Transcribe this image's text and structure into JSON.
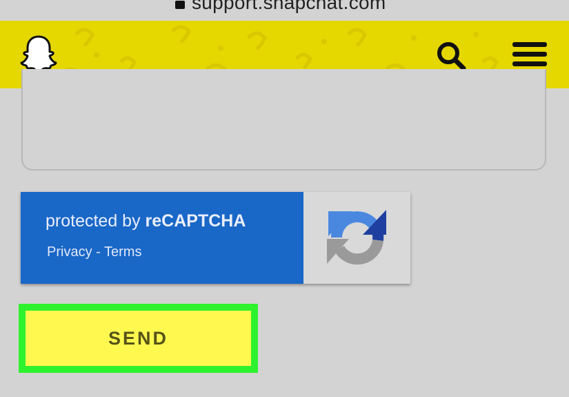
{
  "browser": {
    "url": "support.snapchat.com"
  },
  "header": {
    "logo_icon": "snapchat-ghost-icon",
    "search_icon": "search-icon",
    "menu_icon": "hamburger-menu-icon",
    "background_color": "#e5d700"
  },
  "recaptcha": {
    "protected_prefix": "protected by ",
    "brand": "reCAPTCHA",
    "privacy_label": "Privacy",
    "separator": " - ",
    "terms_label": "Terms",
    "logo_icon": "recaptcha-logo-icon",
    "background_color": "#1967c7"
  },
  "form": {
    "send_label": "SEND",
    "highlight_color": "#2ef22e",
    "button_color": "#fff94f"
  }
}
